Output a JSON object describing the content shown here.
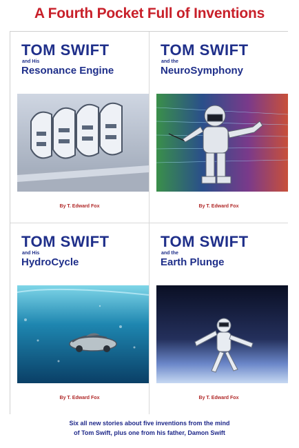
{
  "title": "A Fourth Pocket Full of Inventions",
  "covers": [
    {
      "series": "TOM SWIFT",
      "connector": "and His",
      "subtitle": "Resonance Engine",
      "author": "By T. Edward Fox"
    },
    {
      "series": "TOM SWIFT",
      "connector": "and the",
      "subtitle": "NeuroSymphony",
      "author": "By T. Edward Fox"
    },
    {
      "series": "TOM SWIFT",
      "connector": "and His",
      "subtitle": "HydroCycle",
      "author": "By T. Edward Fox"
    },
    {
      "series": "TOM SWIFT",
      "connector": "and the",
      "subtitle": "Earth Plunge",
      "author": "By T. Edward Fox"
    }
  ],
  "footer": {
    "line1": "Six all new stories about five inventions from the mind",
    "line2": "of Tom Swift, plus one from his father, Damon Swift"
  },
  "colors": {
    "title": "#c8202a",
    "cover_text": "#1f2f8a",
    "byline": "#b02828",
    "footer": "#202a8a"
  }
}
